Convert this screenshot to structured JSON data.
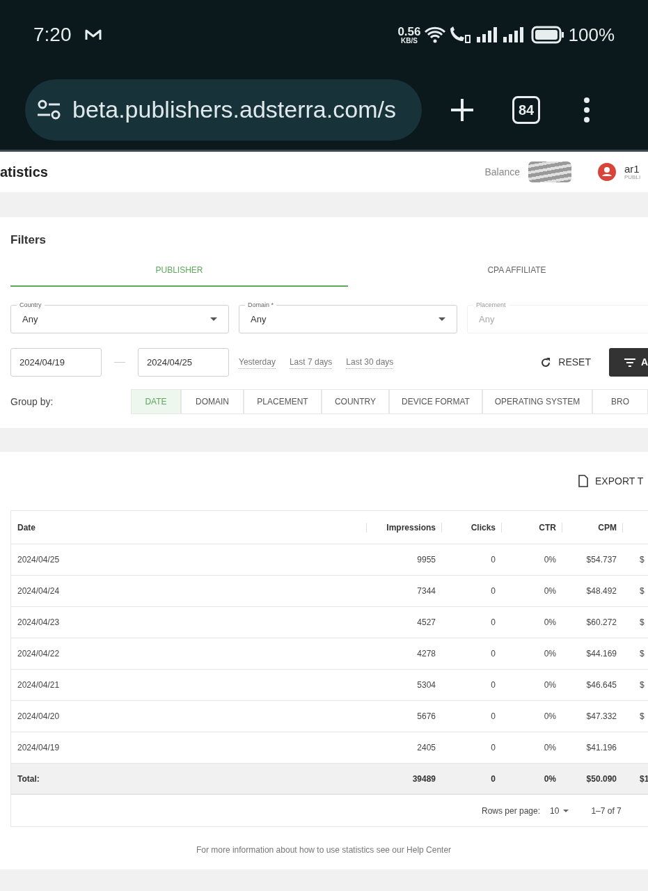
{
  "status_bar": {
    "time": "7:20",
    "speed": "0.56",
    "speed_unit": "KB/S",
    "battery": "100%"
  },
  "browser": {
    "url": "beta.publishers.adsterra.com/s",
    "tab_count": "84"
  },
  "header": {
    "title": "atistics",
    "balance_label": "Balance",
    "user_name": "ar1",
    "user_role": "PUBLI"
  },
  "filters": {
    "title": "Filters",
    "tabs": [
      {
        "label": "PUBLISHER",
        "selected": true
      },
      {
        "label": "CPA AFFILIATE",
        "selected": false
      }
    ],
    "selects": [
      {
        "label": "Country",
        "value": "Any",
        "disabled": false
      },
      {
        "label": "Domain *",
        "value": "Any",
        "disabled": false
      },
      {
        "label": "Placement",
        "value": "Any",
        "disabled": true
      }
    ],
    "date_from": "2024/04/19",
    "date_to": "2024/04/25",
    "presets": [
      "Yesterday",
      "Last 7 days",
      "Last 30 days"
    ],
    "reset": "RESET",
    "apply": "A",
    "group_by_label": "Group by:",
    "group_by": [
      {
        "label": "DATE",
        "selected": true
      },
      {
        "label": "DOMAIN",
        "selected": false
      },
      {
        "label": "PLACEMENT",
        "selected": false
      },
      {
        "label": "COUNTRY",
        "selected": false
      },
      {
        "label": "DEVICE FORMAT",
        "selected": false
      },
      {
        "label": "OPERATING SYSTEM",
        "selected": false
      },
      {
        "label": "BRO",
        "selected": false
      }
    ]
  },
  "table": {
    "export": "EXPORT T",
    "columns": [
      "Date",
      "Impressions",
      "Clicks",
      "CTR",
      "CPM"
    ],
    "rows": [
      [
        "2024/04/25",
        "9955",
        "0",
        "0%",
        "$54.737",
        "$"
      ],
      [
        "2024/04/24",
        "7344",
        "0",
        "0%",
        "$48.492",
        "$"
      ],
      [
        "2024/04/23",
        "4527",
        "0",
        "0%",
        "$60.272",
        "$"
      ],
      [
        "2024/04/22",
        "4278",
        "0",
        "0%",
        "$44.169",
        "$"
      ],
      [
        "2024/04/21",
        "5304",
        "0",
        "0%",
        "$46.645",
        "$"
      ],
      [
        "2024/04/20",
        "5676",
        "0",
        "0%",
        "$47.332",
        "$"
      ],
      [
        "2024/04/19",
        "2405",
        "0",
        "0%",
        "$41.196"
      ]
    ],
    "total": [
      "Total:",
      "39489",
      "0",
      "0%",
      "$50.090",
      "$1"
    ],
    "rows_per_page_label": "Rows per page:",
    "rows_per_page": "10",
    "range": "1–7 of 7"
  },
  "footer_note": "For more information about how to use statistics see our Help Center"
}
